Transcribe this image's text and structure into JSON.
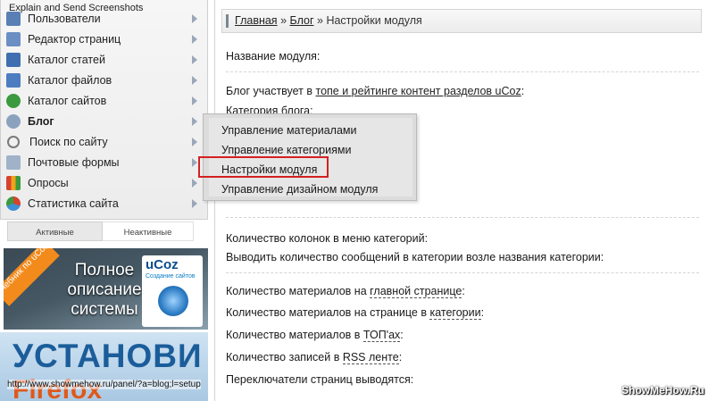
{
  "watermark": {
    "top": "Explain and Send Screenshots",
    "bottom_right": "ShowMeHow.Ru"
  },
  "sidebar": {
    "items": [
      {
        "label": "Пользователи",
        "icon": "users-icon",
        "bold": false,
        "color": "#5a7fb5"
      },
      {
        "label": "Редактор страниц",
        "icon": "page-editor-icon",
        "bold": false,
        "color": "#6b8fc4"
      },
      {
        "label": "Каталог статей",
        "icon": "articles-icon",
        "bold": false,
        "color": "#3f6fb0"
      },
      {
        "label": "Каталог файлов",
        "icon": "files-icon",
        "bold": false,
        "color": "#4d7cc0"
      },
      {
        "label": "Каталог сайтов",
        "icon": "sites-globe-icon",
        "bold": false,
        "color": "#3b9a3f"
      },
      {
        "label": "Блог",
        "icon": "blog-gear-icon",
        "bold": true,
        "color": "#8ba2bf"
      },
      {
        "label": "Поиск по сайту",
        "icon": "search-icon",
        "bold": false,
        "color": "#7a7a7a"
      },
      {
        "label": "Почтовые формы",
        "icon": "mail-forms-icon",
        "bold": false,
        "color": "#9fb2c8"
      },
      {
        "label": "Опросы",
        "icon": "polls-chart-icon",
        "bold": false,
        "color": "#d7422f"
      },
      {
        "label": "Статистика сайта",
        "icon": "stats-pie-icon",
        "bold": false,
        "color": "#3f8fd4"
      }
    ],
    "tabs": {
      "active": "Активные",
      "inactive": "Неактивные"
    }
  },
  "banners": {
    "ucoz": {
      "ribbon": "Учебник по uCoz",
      "headline": "Полное описание системы",
      "brand": "uCoz",
      "tagline": "Создание сайтов"
    },
    "firefox": {
      "line1": "УСТАНОВИ",
      "line2": "Firefox"
    }
  },
  "status_url": "http://www.showmehow.ru/panel/?a=blog;l=setup",
  "breadcrumb": {
    "home": "Главная",
    "sep": "»",
    "blog": "Блог",
    "current": "Настройки модуля"
  },
  "settings": {
    "module_name": "Название модуля:",
    "participation_prefix": "Блог участвует в ",
    "participation_link": "топе и рейтинге контент разделов uCoz",
    "participation_suffix": ":",
    "blog_category": "Категория блога:",
    "category_columns": "Количество колонок в меню категорий:",
    "show_count": "Выводить количество сообщений в категории возле названия категории:",
    "main_page_count_prefix": "Количество материалов на ",
    "main_page_count_link": "главной странице",
    "main_page_count_suffix": ":",
    "category_page_count_prefix": "Количество материалов на странице в ",
    "category_page_count_link": "категории",
    "category_page_count_suffix": ":",
    "top_count_prefix": "Количество материалов в ",
    "top_count_link": "ТОП'ах",
    "top_count_suffix": ":",
    "rss_count_prefix": "Количество записей в ",
    "rss_count_link": "RSS ленте",
    "rss_count_suffix": ":",
    "paging": "Переключатели страниц выводятся:"
  },
  "popup": {
    "items": [
      "Управление материалами",
      "Управление категориями",
      "Настройки модуля",
      "Управление дизайном модуля"
    ],
    "highlighted": "Настройки модуля"
  },
  "colors": {
    "highlight": "#d42020",
    "accent_orange": "#f28b1c",
    "banner_blue": "#1b5d9a"
  }
}
